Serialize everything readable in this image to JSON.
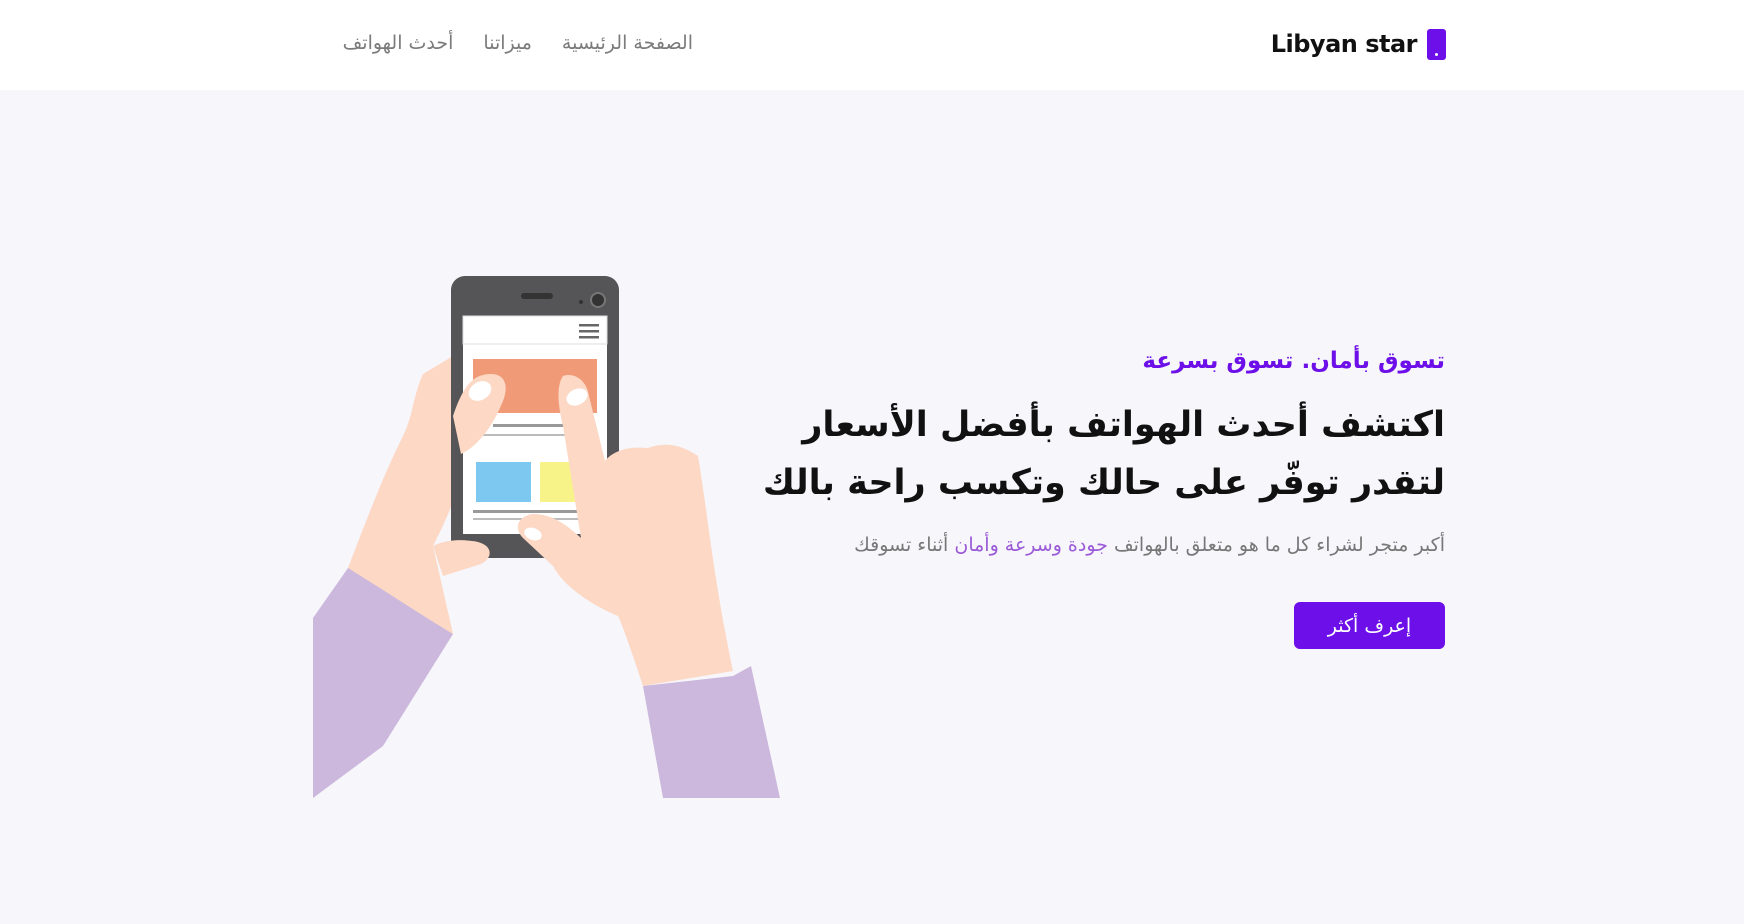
{
  "brand": {
    "name": "Libyan star",
    "icon": "phone-icon",
    "accent": "#6c0fe8"
  },
  "nav": {
    "items": [
      {
        "label": "الصفحة الرئيسية"
      },
      {
        "label": "ميزاتنا"
      },
      {
        "label": "أحدث الهواتف"
      }
    ]
  },
  "hero": {
    "tagline": "تسوق بأمان. تسوق بسرعة",
    "headline_line1": "اكتشف أحدث الهواتف بأفضل الأسعار",
    "headline_line2": "لتقدر توفّر على حالك وتكسب راحة بالك",
    "subtitle_start": "أكبر متجر لشراء كل ما هو متعلق بالهواتف",
    "subtitle_highlight": "جودة وسرعة وأمان",
    "subtitle_end": "أثناء تسوقك",
    "cta_label": "إعرف أكثر"
  },
  "illustration": {
    "icon": "hands-holding-phone-illustration"
  }
}
